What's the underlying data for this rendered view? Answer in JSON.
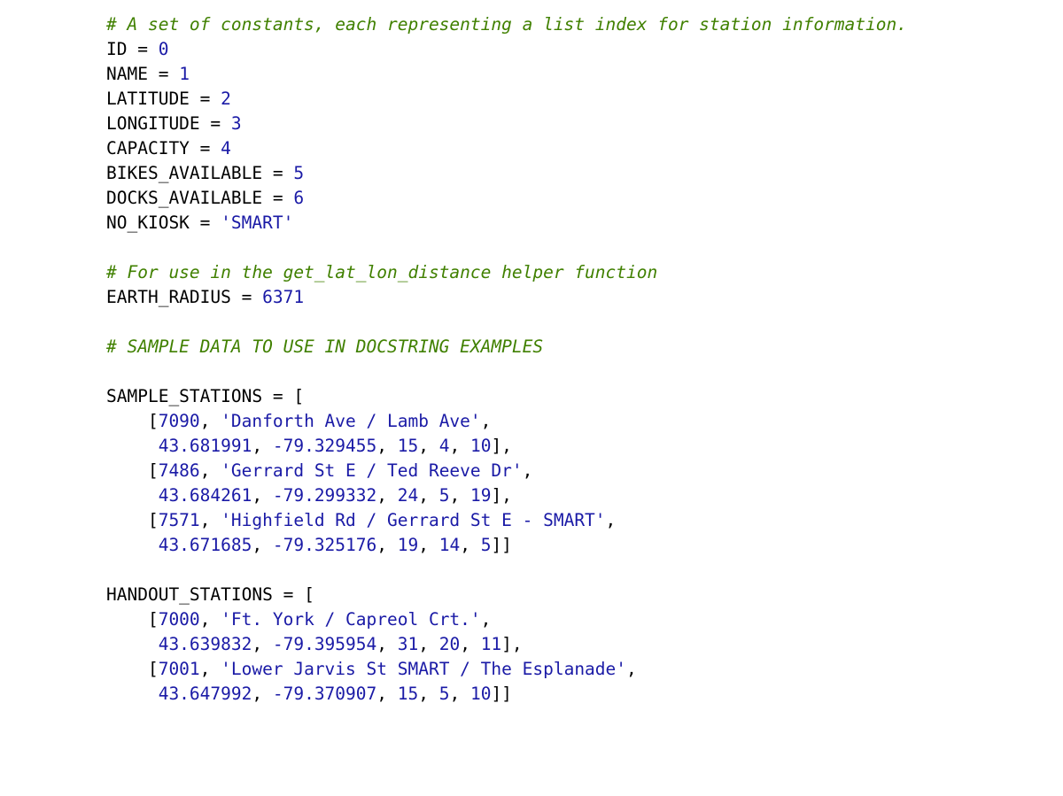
{
  "lines": [
    {
      "spans": [
        {
          "cls": "c",
          "t": "# A set of constants, each representing a list index for station information."
        }
      ]
    },
    {
      "spans": [
        {
          "cls": "n",
          "t": "ID "
        },
        {
          "cls": "o",
          "t": "= "
        },
        {
          "cls": "blu",
          "t": "0"
        }
      ]
    },
    {
      "spans": [
        {
          "cls": "n",
          "t": "NAME "
        },
        {
          "cls": "o",
          "t": "= "
        },
        {
          "cls": "blu",
          "t": "1"
        }
      ]
    },
    {
      "spans": [
        {
          "cls": "n",
          "t": "LATITUDE "
        },
        {
          "cls": "o",
          "t": "= "
        },
        {
          "cls": "blu",
          "t": "2"
        }
      ]
    },
    {
      "spans": [
        {
          "cls": "n",
          "t": "LONGITUDE "
        },
        {
          "cls": "o",
          "t": "= "
        },
        {
          "cls": "blu",
          "t": "3"
        }
      ]
    },
    {
      "spans": [
        {
          "cls": "n",
          "t": "CAPACITY "
        },
        {
          "cls": "o",
          "t": "= "
        },
        {
          "cls": "blu",
          "t": "4"
        }
      ]
    },
    {
      "spans": [
        {
          "cls": "n",
          "t": "BIKES_AVAILABLE "
        },
        {
          "cls": "o",
          "t": "= "
        },
        {
          "cls": "blu",
          "t": "5"
        }
      ]
    },
    {
      "spans": [
        {
          "cls": "n",
          "t": "DOCKS_AVAILABLE "
        },
        {
          "cls": "o",
          "t": "= "
        },
        {
          "cls": "blu",
          "t": "6"
        }
      ]
    },
    {
      "spans": [
        {
          "cls": "n",
          "t": "NO_KIOSK "
        },
        {
          "cls": "o",
          "t": "= "
        },
        {
          "cls": "blu",
          "t": "'SMART'"
        }
      ]
    },
    {
      "spans": [
        {
          "cls": "n",
          "t": ""
        }
      ]
    },
    {
      "spans": [
        {
          "cls": "c",
          "t": "# For use in the get_lat_lon_distance helper function"
        }
      ]
    },
    {
      "spans": [
        {
          "cls": "n",
          "t": "EARTH_RADIUS "
        },
        {
          "cls": "o",
          "t": "= "
        },
        {
          "cls": "blu",
          "t": "6371"
        }
      ]
    },
    {
      "spans": [
        {
          "cls": "n",
          "t": ""
        }
      ]
    },
    {
      "spans": [
        {
          "cls": "c",
          "t": "# SAMPLE DATA TO USE IN DOCSTRING EXAMPLES"
        }
      ]
    },
    {
      "spans": [
        {
          "cls": "n",
          "t": ""
        }
      ]
    },
    {
      "spans": [
        {
          "cls": "n",
          "t": "SAMPLE_STATIONS "
        },
        {
          "cls": "o",
          "t": "= ["
        }
      ]
    },
    {
      "spans": [
        {
          "cls": "o",
          "t": "    ["
        },
        {
          "cls": "blu",
          "t": "7090"
        },
        {
          "cls": "o",
          "t": ", "
        },
        {
          "cls": "blu",
          "t": "'Danforth Ave / Lamb Ave'"
        },
        {
          "cls": "o",
          "t": ","
        }
      ]
    },
    {
      "spans": [
        {
          "cls": "o",
          "t": "     "
        },
        {
          "cls": "blu",
          "t": "43.681991"
        },
        {
          "cls": "o",
          "t": ", "
        },
        {
          "cls": "blu",
          "t": "-79.329455"
        },
        {
          "cls": "o",
          "t": ", "
        },
        {
          "cls": "blu",
          "t": "15"
        },
        {
          "cls": "o",
          "t": ", "
        },
        {
          "cls": "blu",
          "t": "4"
        },
        {
          "cls": "o",
          "t": ", "
        },
        {
          "cls": "blu",
          "t": "10"
        },
        {
          "cls": "o",
          "t": "],"
        }
      ]
    },
    {
      "spans": [
        {
          "cls": "o",
          "t": "    ["
        },
        {
          "cls": "blu",
          "t": "7486"
        },
        {
          "cls": "o",
          "t": ", "
        },
        {
          "cls": "blu",
          "t": "'Gerrard St E / Ted Reeve Dr'"
        },
        {
          "cls": "o",
          "t": ","
        }
      ]
    },
    {
      "spans": [
        {
          "cls": "o",
          "t": "     "
        },
        {
          "cls": "blu",
          "t": "43.684261"
        },
        {
          "cls": "o",
          "t": ", "
        },
        {
          "cls": "blu",
          "t": "-79.299332"
        },
        {
          "cls": "o",
          "t": ", "
        },
        {
          "cls": "blu",
          "t": "24"
        },
        {
          "cls": "o",
          "t": ", "
        },
        {
          "cls": "blu",
          "t": "5"
        },
        {
          "cls": "o",
          "t": ", "
        },
        {
          "cls": "blu",
          "t": "19"
        },
        {
          "cls": "o",
          "t": "],"
        }
      ]
    },
    {
      "spans": [
        {
          "cls": "o",
          "t": "    ["
        },
        {
          "cls": "blu",
          "t": "7571"
        },
        {
          "cls": "o",
          "t": ", "
        },
        {
          "cls": "blu",
          "t": "'Highfield Rd / Gerrard St E - SMART'"
        },
        {
          "cls": "o",
          "t": ","
        }
      ]
    },
    {
      "spans": [
        {
          "cls": "o",
          "t": "     "
        },
        {
          "cls": "blu",
          "t": "43.671685"
        },
        {
          "cls": "o",
          "t": ", "
        },
        {
          "cls": "blu",
          "t": "-79.325176"
        },
        {
          "cls": "o",
          "t": ", "
        },
        {
          "cls": "blu",
          "t": "19"
        },
        {
          "cls": "o",
          "t": ", "
        },
        {
          "cls": "blu",
          "t": "14"
        },
        {
          "cls": "o",
          "t": ", "
        },
        {
          "cls": "blu",
          "t": "5"
        },
        {
          "cls": "o",
          "t": "]]"
        }
      ]
    },
    {
      "spans": [
        {
          "cls": "n",
          "t": ""
        }
      ]
    },
    {
      "spans": [
        {
          "cls": "n",
          "t": "HANDOUT_STATIONS "
        },
        {
          "cls": "o",
          "t": "= ["
        }
      ]
    },
    {
      "spans": [
        {
          "cls": "o",
          "t": "    ["
        },
        {
          "cls": "blu",
          "t": "7000"
        },
        {
          "cls": "o",
          "t": ", "
        },
        {
          "cls": "blu",
          "t": "'Ft. York / Capreol Crt.'"
        },
        {
          "cls": "o",
          "t": ","
        }
      ]
    },
    {
      "spans": [
        {
          "cls": "o",
          "t": "     "
        },
        {
          "cls": "blu",
          "t": "43.639832"
        },
        {
          "cls": "o",
          "t": ", "
        },
        {
          "cls": "blu",
          "t": "-79.395954"
        },
        {
          "cls": "o",
          "t": ", "
        },
        {
          "cls": "blu",
          "t": "31"
        },
        {
          "cls": "o",
          "t": ", "
        },
        {
          "cls": "blu",
          "t": "20"
        },
        {
          "cls": "o",
          "t": ", "
        },
        {
          "cls": "blu",
          "t": "11"
        },
        {
          "cls": "o",
          "t": "],"
        }
      ]
    },
    {
      "spans": [
        {
          "cls": "o",
          "t": "    ["
        },
        {
          "cls": "blu",
          "t": "7001"
        },
        {
          "cls": "o",
          "t": ", "
        },
        {
          "cls": "blu",
          "t": "'Lower Jarvis St SMART / The Esplanade'"
        },
        {
          "cls": "o",
          "t": ","
        }
      ]
    },
    {
      "spans": [
        {
          "cls": "o",
          "t": "     "
        },
        {
          "cls": "blu",
          "t": "43.647992"
        },
        {
          "cls": "o",
          "t": ", "
        },
        {
          "cls": "blu",
          "t": "-79.370907"
        },
        {
          "cls": "o",
          "t": ", "
        },
        {
          "cls": "blu",
          "t": "15"
        },
        {
          "cls": "o",
          "t": ", "
        },
        {
          "cls": "blu",
          "t": "5"
        },
        {
          "cls": "o",
          "t": ", "
        },
        {
          "cls": "blu",
          "t": "10"
        },
        {
          "cls": "o",
          "t": "]]"
        }
      ]
    }
  ]
}
